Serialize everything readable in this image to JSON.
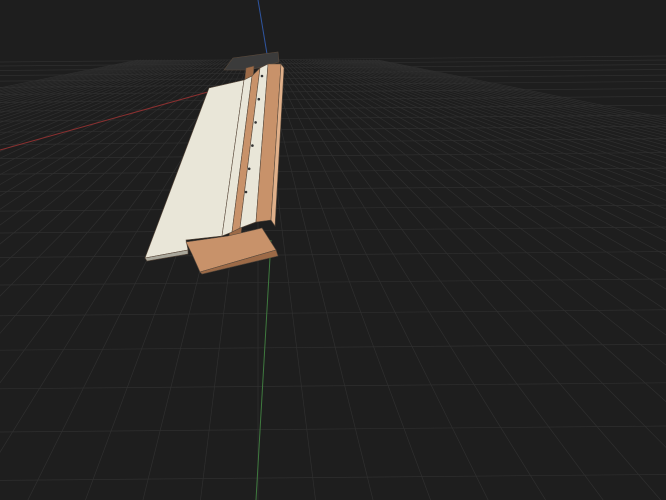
{
  "viewport": {
    "background": "#1e1e1e",
    "grid_visible": true,
    "grid_color": "#2f2f2f",
    "axes": {
      "x_axis_color": "#8a3030",
      "y_axis_color": "#3f7a3f",
      "z_axis_color": "#2f55a0"
    }
  },
  "model": {
    "panel_color": "#e9e6d8",
    "panel_edge_color": "#a9a79b",
    "wood_color": "#c8926a",
    "wood_dark_color": "#9c6a47",
    "wood_light_color": "#e0b08a",
    "cap_color": "#3b3b3b",
    "hole_marks": 6
  }
}
